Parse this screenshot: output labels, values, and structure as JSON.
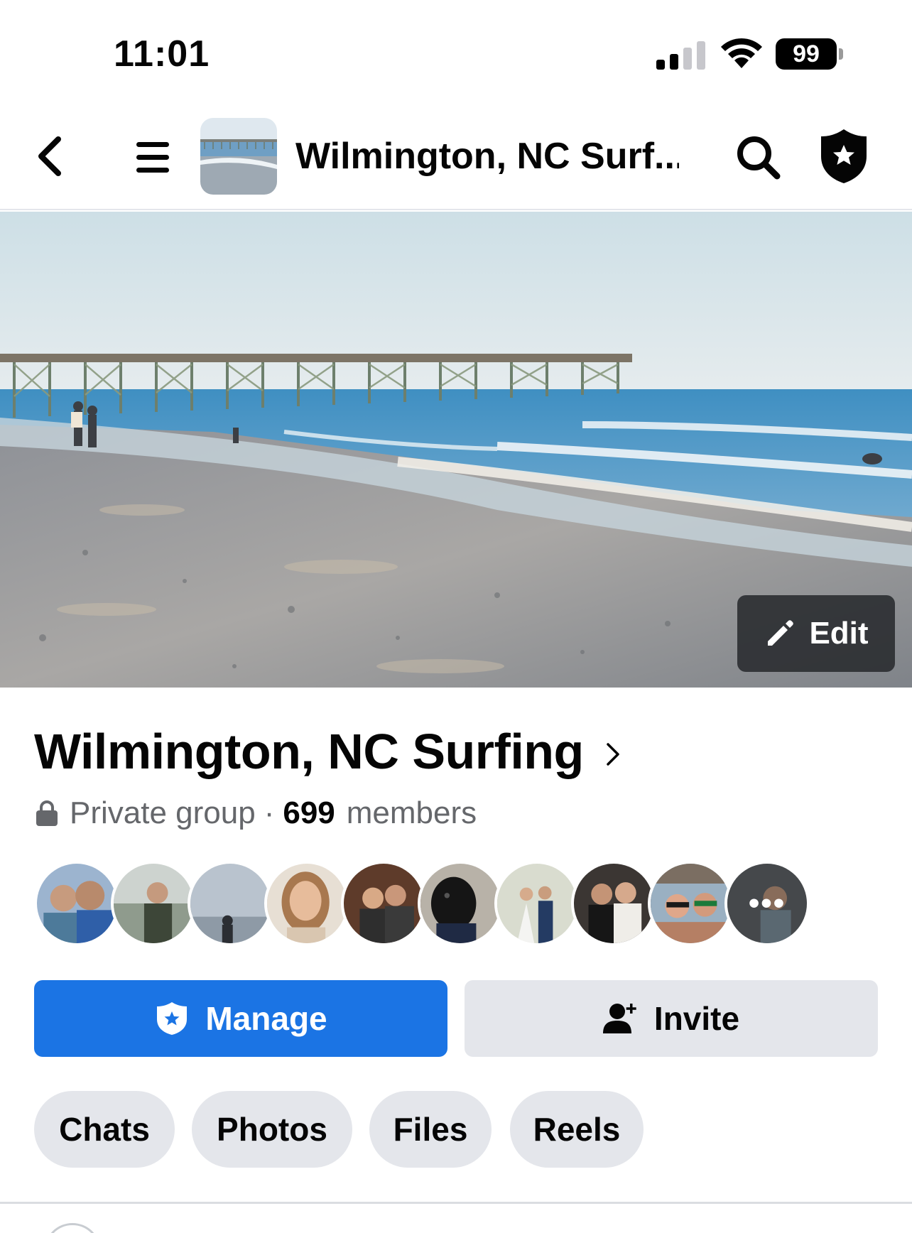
{
  "status_bar": {
    "time": "11:01",
    "battery": "99"
  },
  "nav": {
    "title": "Wilmington, NC Surf..."
  },
  "cover": {
    "edit_label": "Edit"
  },
  "group": {
    "name": "Wilmington, NC Surfing",
    "privacy": "Private group",
    "separator": "·",
    "member_count": "699",
    "members_label": "members"
  },
  "avatars": {
    "more_label": "•••"
  },
  "actions": {
    "manage_label": "Manage",
    "invite_label": "Invite"
  },
  "tabs": [
    {
      "label": "Chats"
    },
    {
      "label": "Photos"
    },
    {
      "label": "Files"
    },
    {
      "label": "Reels"
    }
  ],
  "colors": {
    "accent": "#1b74e4",
    "chip_bg": "#e4e6eb",
    "muted_text": "#65676b"
  }
}
